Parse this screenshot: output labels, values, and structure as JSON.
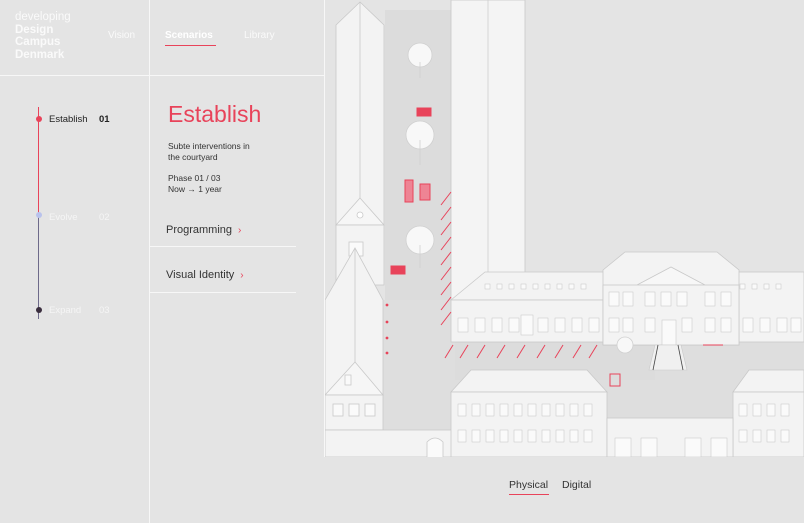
{
  "brand": {
    "pre": "developing",
    "line1": "Design",
    "line2": "Campus",
    "line3": "Denmark"
  },
  "nav": [
    {
      "label": "Vision",
      "active": false
    },
    {
      "label": "Scenarios",
      "active": true
    },
    {
      "label": "Library",
      "active": false
    }
  ],
  "timeline": [
    {
      "label": "Establish",
      "num": "01",
      "active": true
    },
    {
      "label": "Evolve",
      "num": "02",
      "active": false
    },
    {
      "label": "Expand",
      "num": "03",
      "active": false
    }
  ],
  "content": {
    "title": "Establish",
    "desc_line1": "Subte interventions in",
    "desc_line2": "the courtyard",
    "phase": "Phase 01 / 03",
    "duration": "Now → 1 year"
  },
  "menu": [
    {
      "label": "Programming"
    },
    {
      "label": "Visual Identity"
    }
  ],
  "view_toggle": [
    {
      "label": "Physical",
      "active": true
    },
    {
      "label": "Digital",
      "active": false
    }
  ],
  "colors": {
    "accent": "#e8435a",
    "background": "#e4e4e4",
    "lines": "#f7f7f7",
    "timeline_dim": "#6e6a8a"
  }
}
